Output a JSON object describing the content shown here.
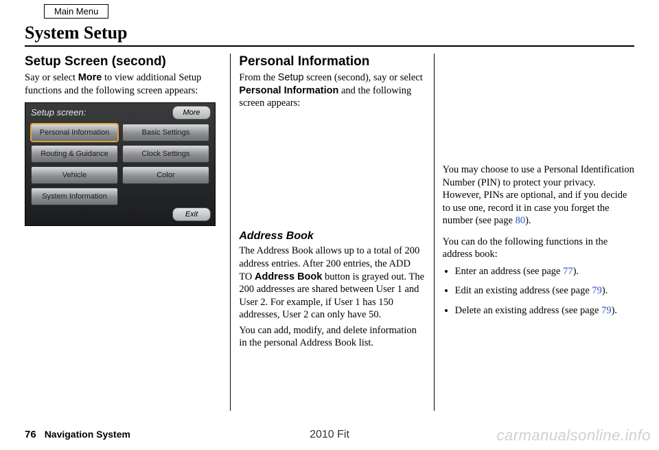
{
  "header": {
    "main_menu": "Main Menu",
    "title": "System Setup"
  },
  "col1": {
    "heading": "Setup Screen (second)",
    "intro_part1": "Say or select ",
    "intro_bold": "More",
    "intro_part2": " to view additional Setup functions and the following screen appears:"
  },
  "screenshot": {
    "title": "Setup screen:",
    "more": "More",
    "exit": "Exit",
    "buttons": {
      "personal_info": "Personal Information",
      "basic_settings": "Basic Settings",
      "routing_guidance": "Routing & Guidance",
      "clock_settings": "Clock Settings",
      "vehicle": "Vehicle",
      "color": "Color",
      "system_info": "System Information"
    }
  },
  "col2": {
    "heading": "Personal Information",
    "intro_part1": "From the ",
    "intro_setup": "Setup",
    "intro_part2": " screen (second), say or select ",
    "intro_bold": "Personal Information",
    "intro_part3": " and the following screen appears:",
    "subheading": "Address Book",
    "addr_para_a": "The Address Book allows up to a total of 200 address entries. After 200 entries, the ADD TO ",
    "addr_bold": "Address Book",
    "addr_para_b": " button is grayed out. The 200 addresses are shared between User 1 and User 2. For example, if User 1 has 150 addresses, User 2 can only have 50.",
    "addr_para2": "You can add, modify, and delete information in the personal Address Book list."
  },
  "col3": {
    "pin_para_a": "You may choose to use a Personal Identification Number (PIN) to protect your privacy. However, PINs are optional, and if you decide to use one, record it in case you forget the number (see page ",
    "pin_link": "80",
    "pin_para_b": ").",
    "func_intro": "You can do the following functions in the address book:",
    "bullets": {
      "b1a": "Enter an address (see page ",
      "b1link": "77",
      "b1b": ").",
      "b2a": "Edit an existing address (see page ",
      "b2link": "79",
      "b2b": ").",
      "b3a": "Delete an existing address (see page ",
      "b3link": "79",
      "b3b": ")."
    }
  },
  "footer": {
    "page_number": "76",
    "section": "Navigation System",
    "model": "2010 Fit",
    "watermark": "carmanualsonline.info"
  }
}
